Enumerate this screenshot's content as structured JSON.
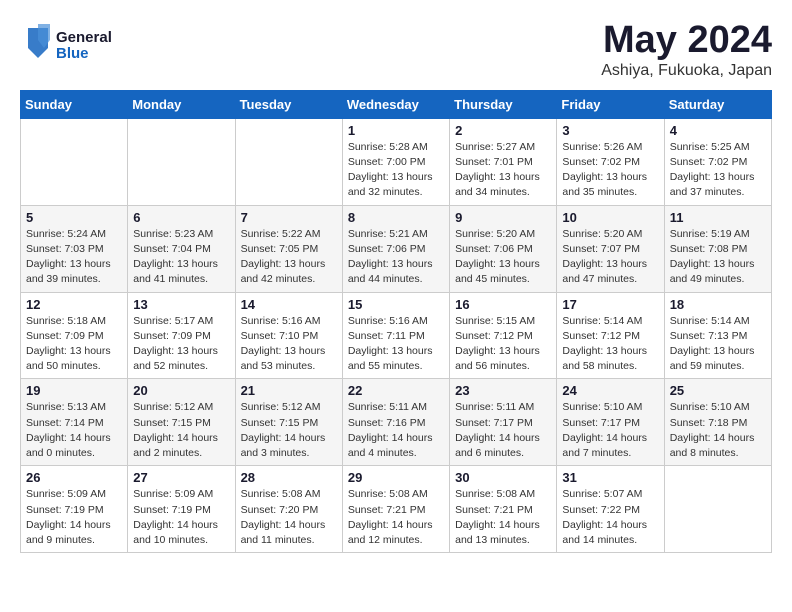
{
  "header": {
    "logo_text_general": "General",
    "logo_text_blue": "Blue",
    "month": "May 2024",
    "location": "Ashiya, Fukuoka, Japan"
  },
  "weekdays": [
    "Sunday",
    "Monday",
    "Tuesday",
    "Wednesday",
    "Thursday",
    "Friday",
    "Saturday"
  ],
  "weeks": [
    [
      {
        "day": "",
        "info": ""
      },
      {
        "day": "",
        "info": ""
      },
      {
        "day": "",
        "info": ""
      },
      {
        "day": "1",
        "info": "Sunrise: 5:28 AM\nSunset: 7:00 PM\nDaylight: 13 hours\nand 32 minutes."
      },
      {
        "day": "2",
        "info": "Sunrise: 5:27 AM\nSunset: 7:01 PM\nDaylight: 13 hours\nand 34 minutes."
      },
      {
        "day": "3",
        "info": "Sunrise: 5:26 AM\nSunset: 7:02 PM\nDaylight: 13 hours\nand 35 minutes."
      },
      {
        "day": "4",
        "info": "Sunrise: 5:25 AM\nSunset: 7:02 PM\nDaylight: 13 hours\nand 37 minutes."
      }
    ],
    [
      {
        "day": "5",
        "info": "Sunrise: 5:24 AM\nSunset: 7:03 PM\nDaylight: 13 hours\nand 39 minutes."
      },
      {
        "day": "6",
        "info": "Sunrise: 5:23 AM\nSunset: 7:04 PM\nDaylight: 13 hours\nand 41 minutes."
      },
      {
        "day": "7",
        "info": "Sunrise: 5:22 AM\nSunset: 7:05 PM\nDaylight: 13 hours\nand 42 minutes."
      },
      {
        "day": "8",
        "info": "Sunrise: 5:21 AM\nSunset: 7:06 PM\nDaylight: 13 hours\nand 44 minutes."
      },
      {
        "day": "9",
        "info": "Sunrise: 5:20 AM\nSunset: 7:06 PM\nDaylight: 13 hours\nand 45 minutes."
      },
      {
        "day": "10",
        "info": "Sunrise: 5:20 AM\nSunset: 7:07 PM\nDaylight: 13 hours\nand 47 minutes."
      },
      {
        "day": "11",
        "info": "Sunrise: 5:19 AM\nSunset: 7:08 PM\nDaylight: 13 hours\nand 49 minutes."
      }
    ],
    [
      {
        "day": "12",
        "info": "Sunrise: 5:18 AM\nSunset: 7:09 PM\nDaylight: 13 hours\nand 50 minutes."
      },
      {
        "day": "13",
        "info": "Sunrise: 5:17 AM\nSunset: 7:09 PM\nDaylight: 13 hours\nand 52 minutes."
      },
      {
        "day": "14",
        "info": "Sunrise: 5:16 AM\nSunset: 7:10 PM\nDaylight: 13 hours\nand 53 minutes."
      },
      {
        "day": "15",
        "info": "Sunrise: 5:16 AM\nSunset: 7:11 PM\nDaylight: 13 hours\nand 55 minutes."
      },
      {
        "day": "16",
        "info": "Sunrise: 5:15 AM\nSunset: 7:12 PM\nDaylight: 13 hours\nand 56 minutes."
      },
      {
        "day": "17",
        "info": "Sunrise: 5:14 AM\nSunset: 7:12 PM\nDaylight: 13 hours\nand 58 minutes."
      },
      {
        "day": "18",
        "info": "Sunrise: 5:14 AM\nSunset: 7:13 PM\nDaylight: 13 hours\nand 59 minutes."
      }
    ],
    [
      {
        "day": "19",
        "info": "Sunrise: 5:13 AM\nSunset: 7:14 PM\nDaylight: 14 hours\nand 0 minutes."
      },
      {
        "day": "20",
        "info": "Sunrise: 5:12 AM\nSunset: 7:15 PM\nDaylight: 14 hours\nand 2 minutes."
      },
      {
        "day": "21",
        "info": "Sunrise: 5:12 AM\nSunset: 7:15 PM\nDaylight: 14 hours\nand 3 minutes."
      },
      {
        "day": "22",
        "info": "Sunrise: 5:11 AM\nSunset: 7:16 PM\nDaylight: 14 hours\nand 4 minutes."
      },
      {
        "day": "23",
        "info": "Sunrise: 5:11 AM\nSunset: 7:17 PM\nDaylight: 14 hours\nand 6 minutes."
      },
      {
        "day": "24",
        "info": "Sunrise: 5:10 AM\nSunset: 7:17 PM\nDaylight: 14 hours\nand 7 minutes."
      },
      {
        "day": "25",
        "info": "Sunrise: 5:10 AM\nSunset: 7:18 PM\nDaylight: 14 hours\nand 8 minutes."
      }
    ],
    [
      {
        "day": "26",
        "info": "Sunrise: 5:09 AM\nSunset: 7:19 PM\nDaylight: 14 hours\nand 9 minutes."
      },
      {
        "day": "27",
        "info": "Sunrise: 5:09 AM\nSunset: 7:19 PM\nDaylight: 14 hours\nand 10 minutes."
      },
      {
        "day": "28",
        "info": "Sunrise: 5:08 AM\nSunset: 7:20 PM\nDaylight: 14 hours\nand 11 minutes."
      },
      {
        "day": "29",
        "info": "Sunrise: 5:08 AM\nSunset: 7:21 PM\nDaylight: 14 hours\nand 12 minutes."
      },
      {
        "day": "30",
        "info": "Sunrise: 5:08 AM\nSunset: 7:21 PM\nDaylight: 14 hours\nand 13 minutes."
      },
      {
        "day": "31",
        "info": "Sunrise: 5:07 AM\nSunset: 7:22 PM\nDaylight: 14 hours\nand 14 minutes."
      },
      {
        "day": "",
        "info": ""
      }
    ]
  ]
}
